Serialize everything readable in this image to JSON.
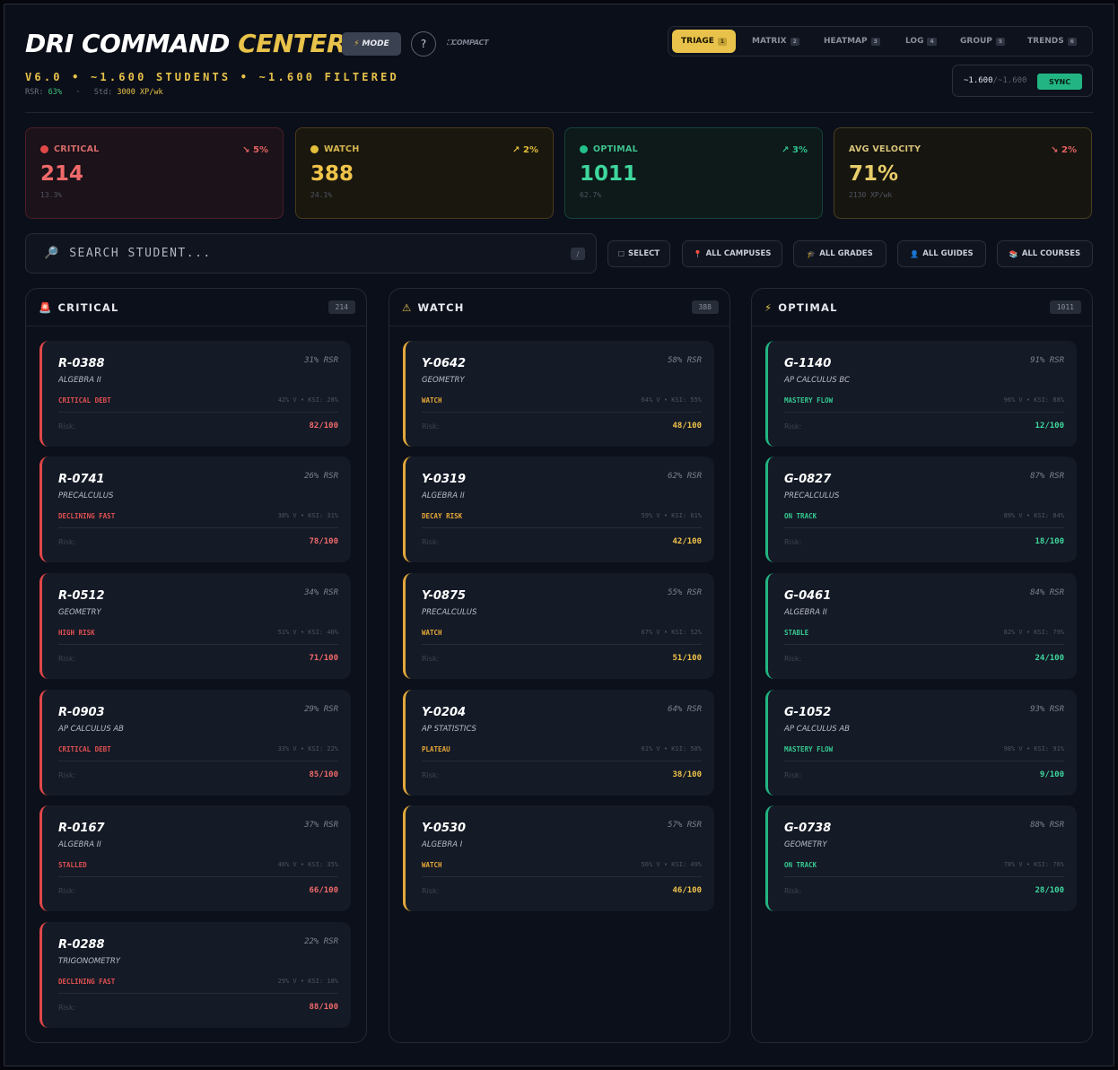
{
  "header": {
    "title_main": "DRI COMMAND",
    "title_accent": "CENTER",
    "mode_label": "MODE",
    "help_label": "?",
    "compact_label": "COMPACT",
    "subtitle": "V6.0 • ~1.600 STUDENTS • ~1.600 FILTERED",
    "rsr_label": "RSR:",
    "rsr_value": "63%",
    "std_label": "Std:",
    "std_value": "3000 XP/wk"
  },
  "view_tabs": [
    {
      "label": "TRIAGE",
      "key": "1",
      "active": true
    },
    {
      "label": "MATRIX",
      "key": "2"
    },
    {
      "label": "HEATMAP",
      "key": "3"
    },
    {
      "label": "LOG",
      "key": "4"
    },
    {
      "label": "GROUP",
      "key": "5"
    },
    {
      "label": "TRENDS",
      "key": "6"
    }
  ],
  "sync": {
    "shown": "~1.600",
    "total": "~1.600",
    "button": "SYNC"
  },
  "stats": {
    "critical": {
      "label": "CRITICAL",
      "trend": "↘ 5%",
      "value": "214",
      "sub": "13.3%"
    },
    "watch": {
      "label": "WATCH",
      "trend": "↗ 2%",
      "value": "388",
      "sub": "24.1%"
    },
    "optimal": {
      "label": "OPTIMAL",
      "trend": "↗ 3%",
      "value": "1011",
      "sub": "62.7%"
    },
    "velocity": {
      "label": "AVG VELOCITY",
      "trend": "↘ 2%",
      "value": "71%",
      "sub": "2130 XP/wk"
    }
  },
  "search": {
    "placeholder": "SEARCH STUDENT...",
    "shortcut": "/"
  },
  "filters": {
    "select": "SELECT",
    "campuses": "ALL CAMPUSES",
    "grades": "ALL GRADES",
    "guides": "ALL GUIDES",
    "courses": "ALL COURSES"
  },
  "columns": {
    "critical": {
      "title": "CRITICAL",
      "count": "214",
      "cards": [
        {
          "id": "R-0388",
          "rsr": "31% RSR",
          "course": "ALGEBRA II",
          "status": "CRITICAL DEBT",
          "ksi": "42% V  •  KSI: 28%",
          "risk_label": "Risk:",
          "risk": "82/100"
        },
        {
          "id": "R-0741",
          "rsr": "26% RSR",
          "course": "PRECALCULUS",
          "status": "DECLINING FAST",
          "ksi": "38% V  •  KSI: 31%",
          "risk_label": "Risk:",
          "risk": "78/100"
        },
        {
          "id": "R-0512",
          "rsr": "34% RSR",
          "course": "GEOMETRY",
          "status": "HIGH RISK",
          "ksi": "51% V  •  KSI: 40%",
          "risk_label": "Risk:",
          "risk": "71/100"
        },
        {
          "id": "R-0903",
          "rsr": "29% RSR",
          "course": "AP CALCULUS AB",
          "status": "CRITICAL DEBT",
          "ksi": "33% V  •  KSI: 22%",
          "risk_label": "Risk:",
          "risk": "85/100"
        },
        {
          "id": "R-0167",
          "rsr": "37% RSR",
          "course": "ALGEBRA II",
          "status": "STALLED",
          "ksi": "46% V  •  KSI: 35%",
          "risk_label": "Risk:",
          "risk": "66/100"
        },
        {
          "id": "R-0288",
          "rsr": "22% RSR",
          "course": "TRIGONOMETRY",
          "status": "DECLINING FAST",
          "ksi": "29% V  •  KSI: 18%",
          "risk_label": "Risk:",
          "risk": "88/100"
        }
      ]
    },
    "watch": {
      "title": "WATCH",
      "count": "388",
      "cards": [
        {
          "id": "Y-0642",
          "rsr": "58% RSR",
          "course": "GEOMETRY",
          "status": "WATCH",
          "ksi": "64% V  •  KSI: 55%",
          "risk_label": "Risk:",
          "risk": "48/100"
        },
        {
          "id": "Y-0319",
          "rsr": "62% RSR",
          "course": "ALGEBRA II",
          "status": "DECAY RISK",
          "ksi": "59% V  •  KSI: 61%",
          "risk_label": "Risk:",
          "risk": "42/100"
        },
        {
          "id": "Y-0875",
          "rsr": "55% RSR",
          "course": "PRECALCULUS",
          "status": "WATCH",
          "ksi": "67% V  •  KSI: 52%",
          "risk_label": "Risk:",
          "risk": "51/100"
        },
        {
          "id": "Y-0204",
          "rsr": "64% RSR",
          "course": "AP STATISTICS",
          "status": "PLATEAU",
          "ksi": "61% V  •  KSI: 58%",
          "risk_label": "Risk:",
          "risk": "38/100"
        },
        {
          "id": "Y-0530",
          "rsr": "57% RSR",
          "course": "ALGEBRA I",
          "status": "WATCH",
          "ksi": "56% V  •  KSI: 49%",
          "risk_label": "Risk:",
          "risk": "46/100"
        }
      ]
    },
    "optimal": {
      "title": "OPTIMAL",
      "count": "1011",
      "cards": [
        {
          "id": "G-1140",
          "rsr": "91% RSR",
          "course": "AP CALCULUS BC",
          "status": "MASTERY FLOW",
          "ksi": "96% V  •  KSI: 88%",
          "risk_label": "Risk:",
          "risk": "12/100"
        },
        {
          "id": "G-0827",
          "rsr": "87% RSR",
          "course": "PRECALCULUS",
          "status": "ON TRACK",
          "ksi": "89% V  •  KSI: 84%",
          "risk_label": "Risk:",
          "risk": "18/100"
        },
        {
          "id": "G-0461",
          "rsr": "84% RSR",
          "course": "ALGEBRA II",
          "status": "STABLE",
          "ksi": "82% V  •  KSI: 79%",
          "risk_label": "Risk:",
          "risk": "24/100"
        },
        {
          "id": "G-1052",
          "rsr": "93% RSR",
          "course": "AP CALCULUS AB",
          "status": "MASTERY FLOW",
          "ksi": "98% V  •  KSI: 91%",
          "risk_label": "Risk:",
          "risk": "9/100"
        },
        {
          "id": "G-0738",
          "rsr": "88% RSR",
          "course": "GEOMETRY",
          "status": "ON TRACK",
          "ksi": "78% V  •  KSI: 76%",
          "risk_label": "Risk:",
          "risk": "28/100"
        }
      ]
    }
  }
}
